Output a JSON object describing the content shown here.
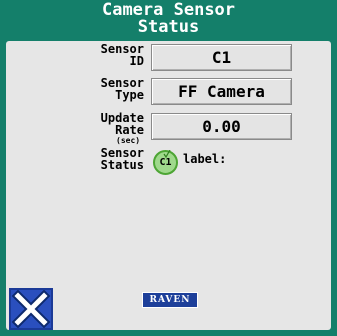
{
  "window": {
    "title_line1": "Camera Sensor",
    "title_line2": "Status"
  },
  "fields": {
    "sensor_id": {
      "label_line1": "Sensor",
      "label_line2": "ID",
      "value": "C1"
    },
    "sensor_type": {
      "label_line1": "Sensor",
      "label_line2": "Type",
      "value": "FF Camera"
    },
    "update_rate": {
      "label_line1": "Update",
      "label_line2": "Rate",
      "unit": "(sec)",
      "value": "0.00"
    },
    "sensor_status": {
      "label_line1": "Sensor",
      "label_line2": "Status",
      "badge": "C1",
      "status_text": "label:"
    }
  },
  "footer": {
    "close_icon": "close-x-icon",
    "logo_text": "RAVEN"
  },
  "colors": {
    "frame": "#147f6a",
    "panel": "#e6e6e6",
    "status_ok": "#9fd98c",
    "close_button": "#2a4fbe",
    "logo": "#1d3f9a"
  }
}
